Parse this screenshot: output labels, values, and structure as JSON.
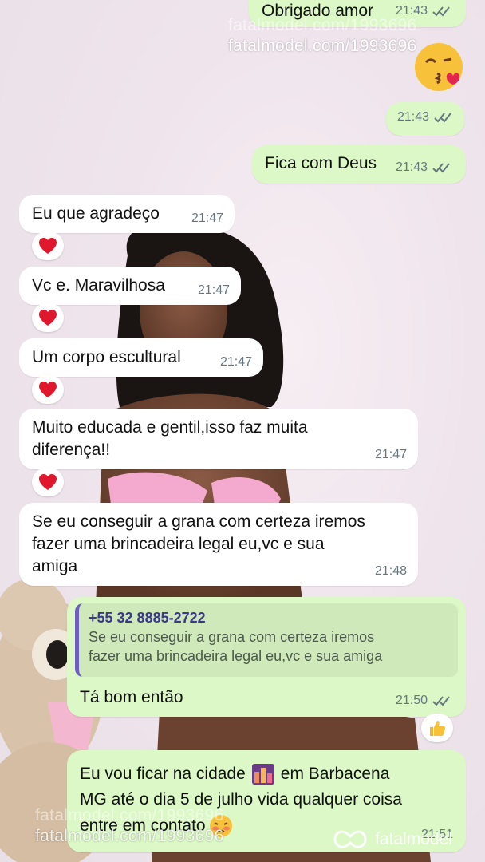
{
  "watermark": {
    "top_line_faded": "fatalmodel.com/1993696",
    "top_line": "fatalmodel.com/1993696",
    "bottom_line_faded": "fatalmodel.com/1993696",
    "bottom_line": "fatalmodel.com/1993696",
    "brand": "fatalmodel"
  },
  "colors": {
    "incoming_bubble": "#ffffff",
    "outgoing_bubble": "#dcf8c6",
    "quote_bar": "#6e5bc4"
  },
  "messages": [
    {
      "id": "m1",
      "direction": "out",
      "text": "Obrigado amor",
      "time": "21:43",
      "status": "read-double-check"
    },
    {
      "id": "m2",
      "direction": "out",
      "emoji": "kissing-heart-emoji",
      "time": "21:43",
      "status": "read-double-check"
    },
    {
      "id": "m3",
      "direction": "out",
      "text": "Fica com Deus",
      "time": "21:43",
      "status": "read-double-check"
    },
    {
      "id": "m4",
      "direction": "in",
      "text": "Eu que agradeço",
      "time": "21:47",
      "reaction": "heart-icon"
    },
    {
      "id": "m5",
      "direction": "in",
      "text": "Vc e. Maravilhosa",
      "time": "21:47",
      "reaction": "heart-icon"
    },
    {
      "id": "m6",
      "direction": "in",
      "text": "Um corpo escultural",
      "time": "21:47",
      "reaction": "heart-icon"
    },
    {
      "id": "m7",
      "direction": "in",
      "text_lines": [
        "Muito educada e gentil,isso faz muita",
        "diferença!!"
      ],
      "time": "21:47",
      "reaction": "heart-icon"
    },
    {
      "id": "m8",
      "direction": "in",
      "text_lines": [
        "Se eu conseguir a grana com certeza iremos",
        "fazer uma brincadeira legal eu,vc e sua",
        "amiga"
      ],
      "time": "21:48"
    },
    {
      "id": "m9",
      "direction": "out",
      "quote": {
        "sender": "+55 32 8885-2722",
        "text_lines": [
          "Se eu conseguir a grana com certeza iremos",
          "fazer uma brincadeira legal eu,vc e sua amiga"
        ]
      },
      "text": "Tá bom então",
      "time": "21:50",
      "status": "read-double-check",
      "reaction": "thumbs-up-icon"
    },
    {
      "id": "m10",
      "direction": "out",
      "text_lines": [
        "Eu vou ficar na cidade",
        "em Barbacena",
        "MG até o dia 5 de julho vida qualquer coisa",
        "entre em contato"
      ],
      "inline_emoji": [
        "city-emoji",
        "blushing-emoji"
      ],
      "time": "21:51"
    }
  ]
}
